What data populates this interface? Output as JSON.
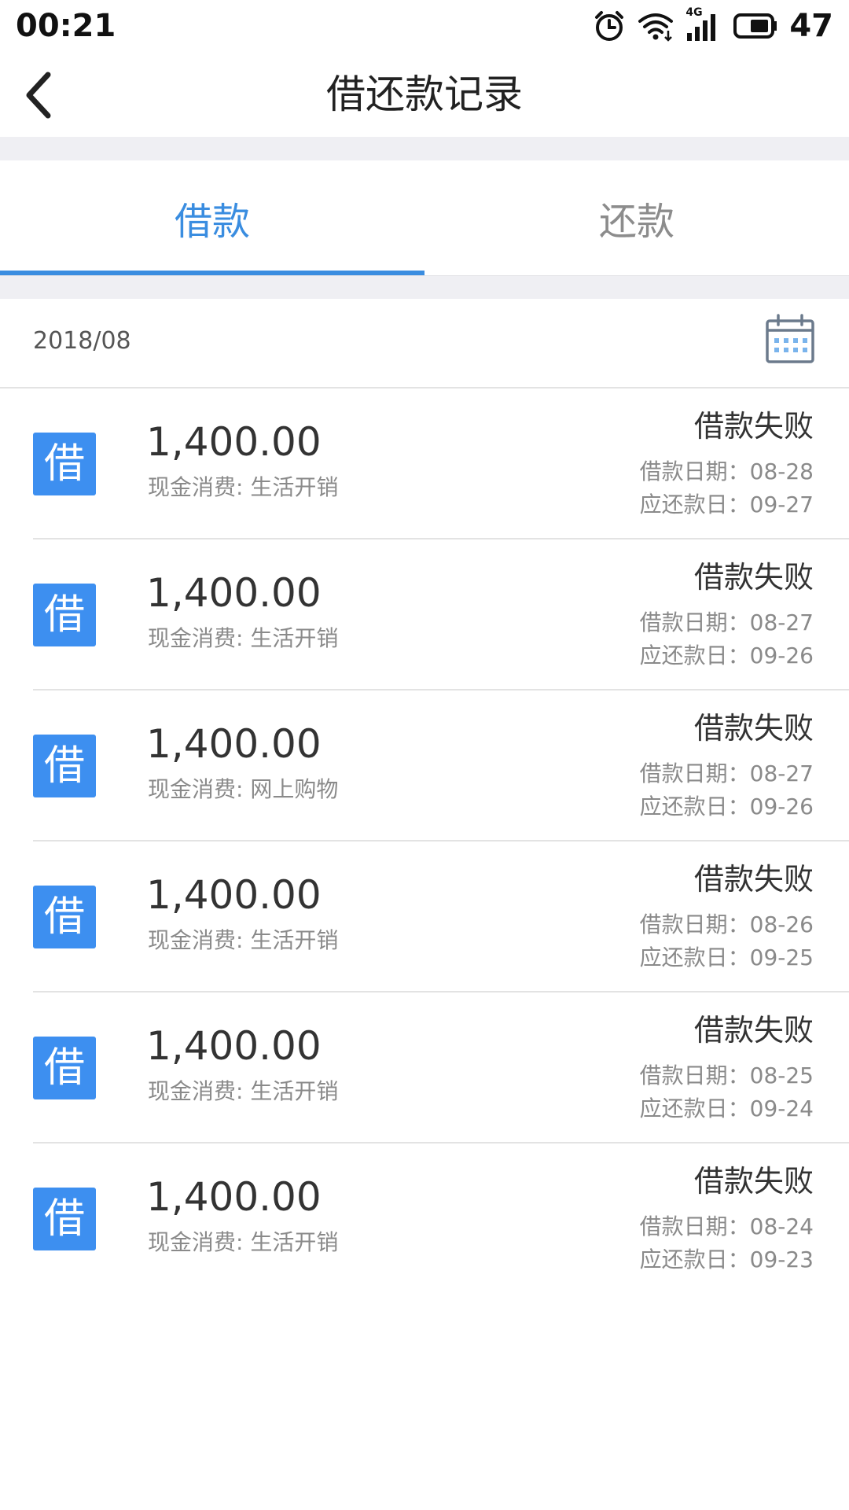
{
  "status_bar": {
    "time": "00:21",
    "network": "4G",
    "battery": "47",
    "icons": [
      "alarm-icon",
      "wifi-icon",
      "signal-icon",
      "battery-icon"
    ]
  },
  "nav": {
    "title": "借还款记录",
    "back_icon": "chevron-left-icon"
  },
  "tabs": [
    {
      "label": "借款",
      "active": true
    },
    {
      "label": "还款",
      "active": false
    }
  ],
  "month": {
    "label": "2018/08",
    "calendar_icon": "calendar-icon"
  },
  "colors": {
    "accent": "#3a8de0",
    "badge": "#3d8ff0"
  },
  "records": [
    {
      "badge": "借",
      "amount": "1,400.00",
      "desc": "现金消费: 生活开销",
      "status": "借款失败",
      "loan_date": "借款日期：08-28",
      "due_date": "应还款日：09-27"
    },
    {
      "badge": "借",
      "amount": "1,400.00",
      "desc": "现金消费: 生活开销",
      "status": "借款失败",
      "loan_date": "借款日期：08-27",
      "due_date": "应还款日：09-26"
    },
    {
      "badge": "借",
      "amount": "1,400.00",
      "desc": "现金消费: 网上购物",
      "status": "借款失败",
      "loan_date": "借款日期：08-27",
      "due_date": "应还款日：09-26"
    },
    {
      "badge": "借",
      "amount": "1,400.00",
      "desc": "现金消费: 生活开销",
      "status": "借款失败",
      "loan_date": "借款日期：08-26",
      "due_date": "应还款日：09-25"
    },
    {
      "badge": "借",
      "amount": "1,400.00",
      "desc": "现金消费: 生活开销",
      "status": "借款失败",
      "loan_date": "借款日期：08-25",
      "due_date": "应还款日：09-24"
    },
    {
      "badge": "借",
      "amount": "1,400.00",
      "desc": "现金消费: 生活开销",
      "status": "借款失败",
      "loan_date": "借款日期：08-24",
      "due_date": "应还款日：09-23"
    }
  ]
}
